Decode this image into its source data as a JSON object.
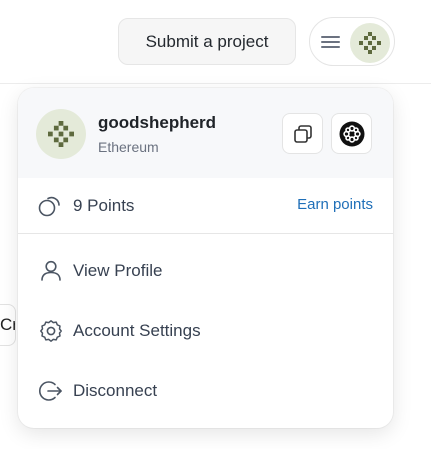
{
  "header": {
    "submit_label": "Submit a project"
  },
  "background": {
    "partial_button_text": "Cre"
  },
  "dropdown": {
    "user": {
      "name": "goodshepherd",
      "network": "Ethereum"
    },
    "points": {
      "label": "9 Points",
      "earn_label": "Earn points"
    },
    "items": [
      {
        "label": "View Profile",
        "icon": "user-icon"
      },
      {
        "label": "Account Settings",
        "icon": "gear-icon"
      },
      {
        "label": "Disconnect",
        "icon": "logout-icon"
      }
    ]
  },
  "colors": {
    "link": "#1f6fb8",
    "avatar_bg": "#e4ead9",
    "avatar_mark": "#5e6a3e",
    "header_bg": "#f7f8fa"
  }
}
